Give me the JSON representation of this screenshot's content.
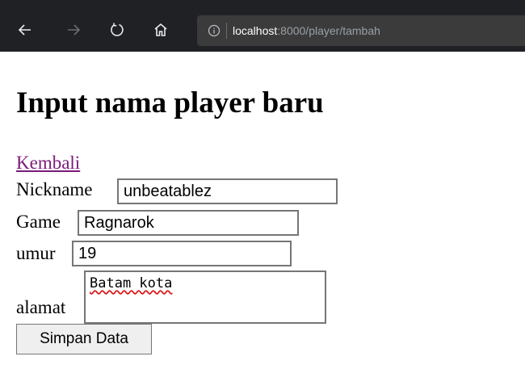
{
  "browser": {
    "url_host": "localhost",
    "url_rest": ":8000/player/tambah",
    "icons": {
      "back": "back-arrow-icon",
      "forward": "forward-arrow-icon",
      "refresh": "refresh-icon",
      "home": "home-icon",
      "info": "info-icon"
    }
  },
  "page": {
    "title": "Input nama player baru",
    "back_link": "Kembali",
    "form": {
      "nickname_label": "Nickname",
      "nickname_value": "unbeatablez",
      "game_label": "Game",
      "game_value": "Ragnarok",
      "umur_label": "umur",
      "umur_value": "19",
      "alamat_label": "alamat",
      "alamat_value": "Batam kota",
      "submit_label": "Simpan Data"
    }
  },
  "colors": {
    "toolbar_bg": "#202124",
    "link_visited": "#7b1a7b",
    "input_border": "#767676",
    "button_bg": "#efefef"
  }
}
